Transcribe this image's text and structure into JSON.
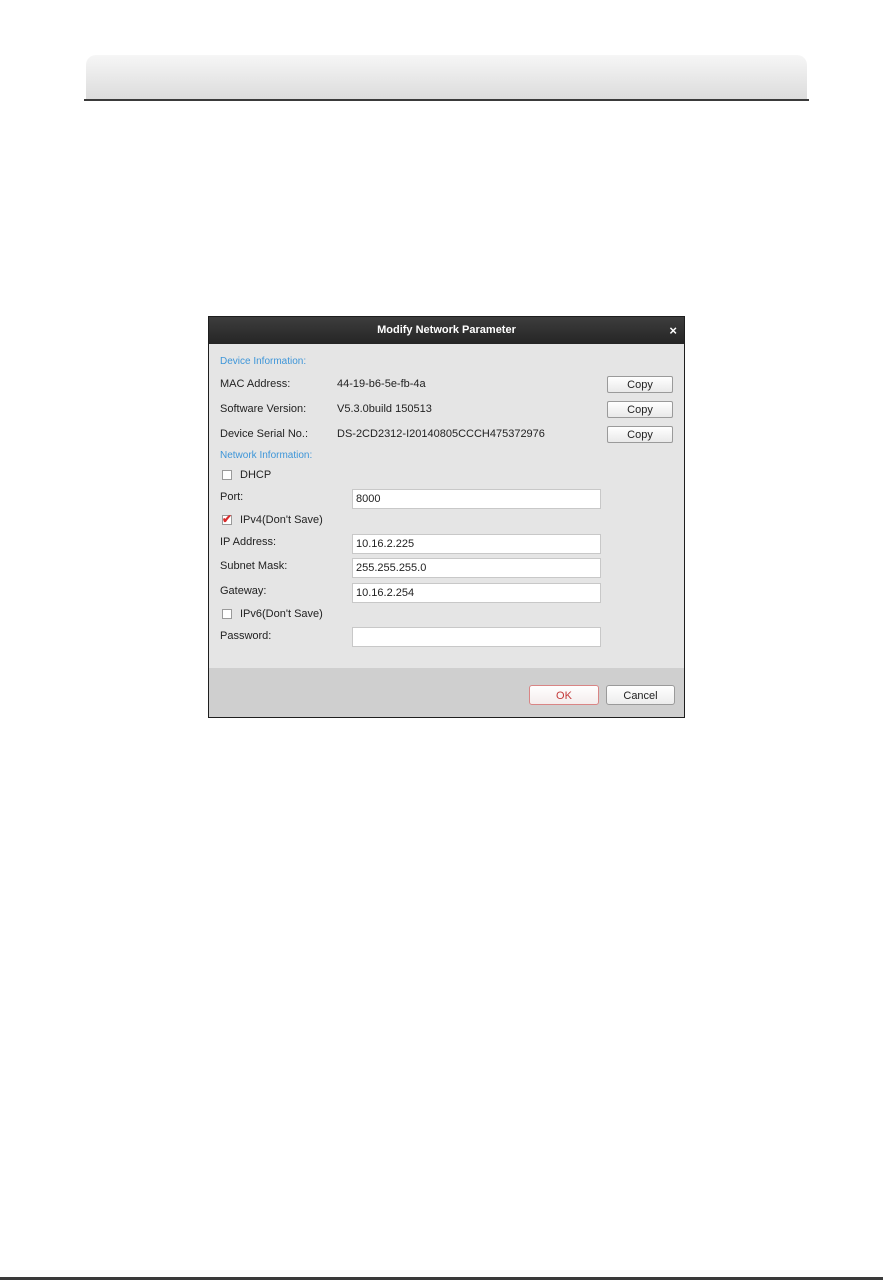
{
  "dialog": {
    "title": "Modify Network Parameter",
    "close_icon": "×",
    "device_info": {
      "section_label": "Device Information:",
      "mac_label": "MAC Address:",
      "mac_value": "44-19-b6-5e-fb-4a",
      "software_label": "Software Version:",
      "software_value": "V5.3.0build 150513",
      "serial_label": "Device Serial No.:",
      "serial_value": "DS-2CD2312-I20140805CCCH475372976",
      "copy_label": "Copy"
    },
    "network_info": {
      "section_label": "Network Information:",
      "dhcp_label": "DHCP",
      "dhcp_checked": false,
      "port_label": "Port:",
      "port_value": "8000",
      "ipv4_label": "IPv4(Don't Save)",
      "ipv4_checked": true,
      "ip_label": "IP Address:",
      "ip_value": "10.16.2.225",
      "subnet_label": "Subnet Mask:",
      "subnet_value": "255.255.255.0",
      "gateway_label": "Gateway:",
      "gateway_value": "10.16.2.254",
      "ipv6_label": "IPv6(Don't Save)",
      "ipv6_checked": false,
      "password_label": "Password:",
      "password_value": ""
    },
    "buttons": {
      "ok_label": "OK",
      "cancel_label": "Cancel"
    },
    "colors": {
      "section_blue": "#3d95d8",
      "ok_red": "#c43b3b",
      "titlebar": "#2e2e2e"
    }
  }
}
